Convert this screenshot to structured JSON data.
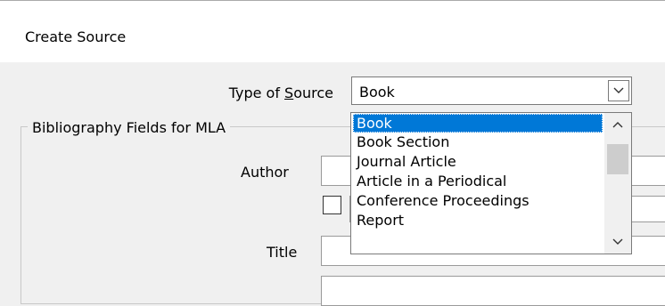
{
  "window": {
    "title": "Create Source"
  },
  "source_type": {
    "label_before": "Type of ",
    "label_accel": "S",
    "label_after": "ource",
    "selected": "Book",
    "options": [
      "Book",
      "Book Section",
      "Journal Article",
      "Article in a Periodical",
      "Conference Proceedings",
      "Report"
    ],
    "highlighted_index": 0
  },
  "bibliography": {
    "group_label": "Bibliography Fields for MLA",
    "author_label": "Author",
    "author_value": "",
    "title_label": "Title",
    "title_value": ""
  },
  "icons": {
    "dropdown": "chevron-down-icon",
    "scroll_up": "chevron-up-icon",
    "scroll_down": "chevron-down-icon"
  },
  "colors": {
    "selection": "#0078d7",
    "background": "#f0f0f0"
  }
}
